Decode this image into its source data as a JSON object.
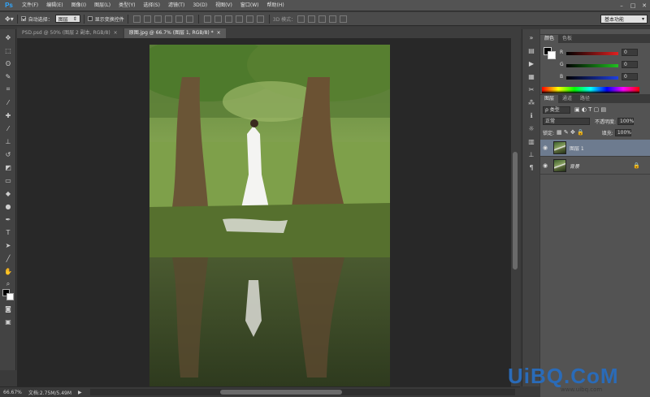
{
  "menubar": {
    "logo": "Ps",
    "items": [
      "文件(F)",
      "编辑(E)",
      "图像(I)",
      "图层(L)",
      "类型(Y)",
      "选择(S)",
      "滤镜(T)",
      "3D(D)",
      "视图(V)",
      "窗口(W)",
      "帮助(H)"
    ],
    "window_controls": [
      "–",
      "□",
      "✕"
    ]
  },
  "options": {
    "auto_select_label": "自动选择：",
    "auto_select_value": "图层",
    "transform_label": "显示变换控件",
    "mode_3d_label": "3D 模式：",
    "workspace": "基本功能"
  },
  "tabs": [
    {
      "label": "PSD.psd @ 50% (图层 2 副本, RGB/8)",
      "close": "×"
    },
    {
      "label": "原图.jpg @ 66.7% (图层 1, RGB/8) *",
      "close": "×"
    }
  ],
  "status": {
    "zoom": "66.67%",
    "doc_info": "文档:2.75M/5.49M",
    "arrow": "▶"
  },
  "color_panel": {
    "tabs": [
      "颜色",
      "色板"
    ],
    "sliders": [
      {
        "label": "R",
        "value": "0",
        "color": "#d23a3a"
      },
      {
        "label": "G",
        "value": "0",
        "color": "#3aa03a"
      },
      {
        "label": "B",
        "value": "0",
        "color": "#3a4ad2"
      }
    ]
  },
  "layers_panel": {
    "tabs": [
      "图层",
      "通道",
      "路径"
    ],
    "filter_label": "ρ 类型",
    "blend_mode": "正常",
    "opacity_label": "不透明度:",
    "opacity_value": "100%",
    "lock_label": "锁定:",
    "fill_label": "填充:",
    "fill_value": "100%",
    "layers": [
      {
        "name": "图层 1",
        "selected": true
      },
      {
        "name": "背景",
        "selected": false,
        "locked": true
      }
    ]
  },
  "watermark": "UiBQ.CoM",
  "watermark_sub": "www.uibq.com"
}
